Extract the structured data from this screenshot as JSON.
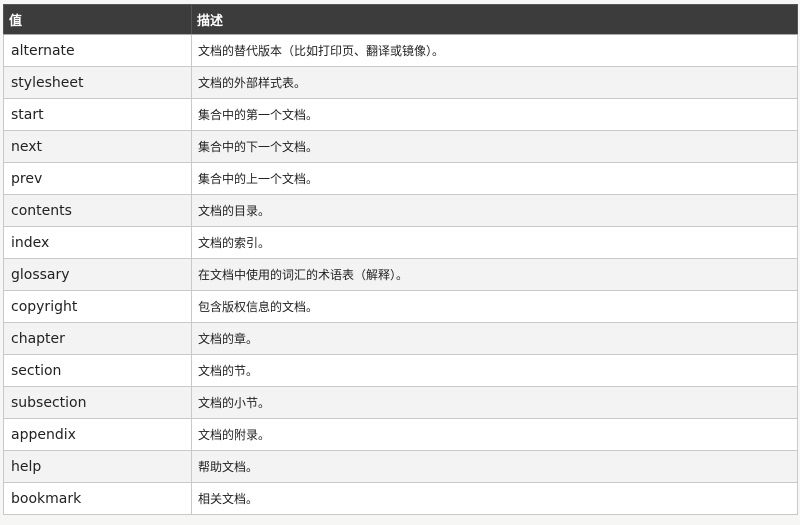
{
  "table": {
    "headers": [
      "值",
      "描述"
    ],
    "rows": [
      {
        "value": "alternate",
        "description": "文档的替代版本（比如打印页、翻译或镜像）。"
      },
      {
        "value": "stylesheet",
        "description": "文档的外部样式表。"
      },
      {
        "value": "start",
        "description": "集合中的第一个文档。"
      },
      {
        "value": "next",
        "description": "集合中的下一个文档。"
      },
      {
        "value": "prev",
        "description": "集合中的上一个文档。"
      },
      {
        "value": "contents",
        "description": "文档的目录。"
      },
      {
        "value": "index",
        "description": "文档的索引。"
      },
      {
        "value": "glossary",
        "description": "在文档中使用的词汇的术语表（解释）。"
      },
      {
        "value": "copyright",
        "description": "包含版权信息的文档。"
      },
      {
        "value": "chapter",
        "description": "文档的章。"
      },
      {
        "value": "section",
        "description": "文档的节。"
      },
      {
        "value": "subsection",
        "description": "文档的小节。"
      },
      {
        "value": "appendix",
        "description": "文档的附录。"
      },
      {
        "value": "help",
        "description": "帮助文档。"
      },
      {
        "value": "bookmark",
        "description": "相关文档。"
      }
    ]
  },
  "colors": {
    "header_background": "#3c3c3c",
    "header_text": "#ffffff",
    "row_alt_background": "#f3f3f3",
    "border": "#c9c9c9"
  }
}
